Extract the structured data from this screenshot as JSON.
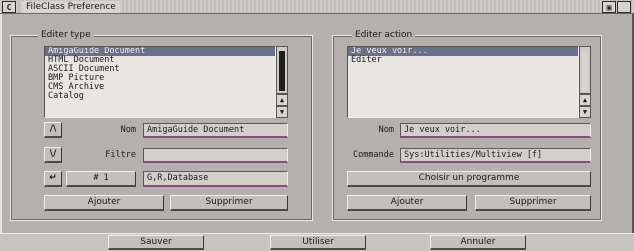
{
  "window": {
    "close_gadget": "C",
    "title": "FileClass Preference",
    "depth_gadget": "▣"
  },
  "edit_type": {
    "group_label": "Editer type",
    "items": [
      {
        "label": "AmigaGuide Document",
        "selected": true
      },
      {
        "label": "HTML Document",
        "selected": false
      },
      {
        "label": "ASCII Document",
        "selected": false
      },
      {
        "label": "BMP Picture",
        "selected": false
      },
      {
        "label": "CMS Archive",
        "selected": false
      },
      {
        "label": "Catalog",
        "selected": false
      }
    ],
    "scroll_up": "▲",
    "scroll_down": "▼",
    "move_up_button": "/\\",
    "move_down_button": "\\/",
    "name_label": "Nom",
    "name_value": "AmigaGuide Document",
    "filter_label": "Filtre",
    "filter_value": "",
    "cycle_button": "↵",
    "number_value": "# 1",
    "database_value": "G,R,Database",
    "add_button": "Ajouter",
    "delete_button": "Supprimer"
  },
  "edit_action": {
    "group_label": "Editer action",
    "items": [
      {
        "label": "Je veux voir...",
        "selected": true
      },
      {
        "label": "Editer",
        "selected": false
      }
    ],
    "scroll_up": "▲",
    "scroll_down": "▼",
    "name_label": "Nom",
    "name_value": "Je veux voir...",
    "command_label": "Commande",
    "command_value": "Sys:Utilities/Multiview [f]",
    "choose_program_button": "Choisir un programme",
    "add_button": "Ajouter",
    "delete_button": "Supprimer"
  },
  "footer": {
    "save_button": "Sauver",
    "use_button": "Utiliser",
    "cancel_button": "Annuler"
  },
  "colors": {
    "background": "#b3b0ad",
    "selection": "#6a6f8a",
    "field_underline": "#8a4e7a"
  }
}
